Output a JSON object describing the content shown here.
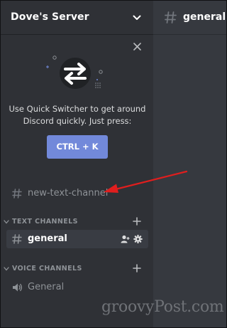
{
  "server": {
    "name": "Dove's Server"
  },
  "quick_switcher": {
    "text_line1": "Use Quick Switcher to get around",
    "text_line2": "Discord quickly. Just press:",
    "button_label": "CTRL + K"
  },
  "channels": {
    "uncategorized": [
      {
        "name": "new-text-channel"
      }
    ],
    "text_category": {
      "label": "TEXT CHANNELS",
      "items": [
        {
          "name": "general"
        }
      ]
    },
    "voice_category": {
      "label": "VOICE CHANNELS",
      "items": [
        {
          "name": "General"
        }
      ]
    }
  },
  "main": {
    "channel_title": "general"
  },
  "watermark": "groovyPost.com",
  "colors": {
    "sidebar_bg": "#2f3136",
    "main_bg": "#36393f",
    "accent": "#7289da",
    "annotation_arrow": "#e01e1e"
  }
}
